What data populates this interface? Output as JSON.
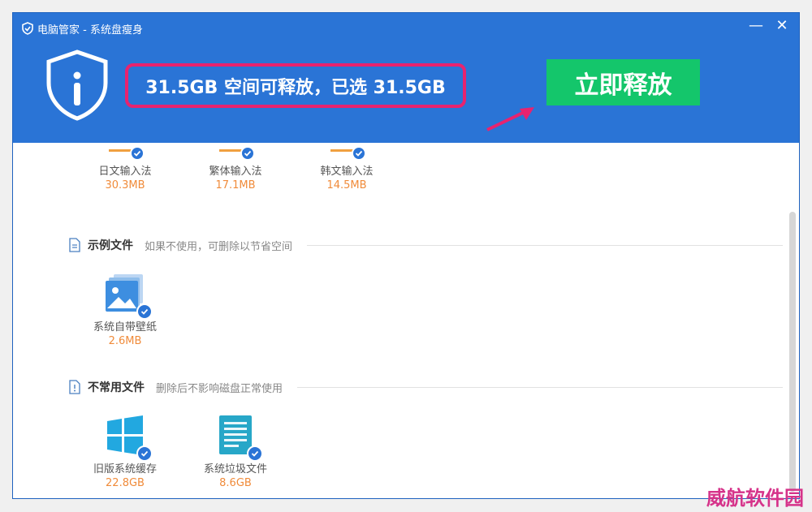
{
  "window": {
    "title": "电脑管家 - 系统盘瘦身"
  },
  "header": {
    "status_text": "31.5GB 空间可释放，已选 31.5GB",
    "release_button": "立即释放",
    "colors": {
      "header_bg": "#2a74d6",
      "button_bg": "#14c66b",
      "highlight": "#e8236f"
    }
  },
  "ime_items": [
    {
      "label": "日文输入法",
      "size": "30.3MB"
    },
    {
      "label": "繁体输入法",
      "size": "17.1MB"
    },
    {
      "label": "韩文输入法",
      "size": "14.5MB"
    }
  ],
  "sections": [
    {
      "title": "示例文件",
      "desc": "如果不使用，可删除以节省空间",
      "items": [
        {
          "label": "系统自带壁纸",
          "size": "2.6MB",
          "icon": "wallpaper-icon"
        }
      ]
    },
    {
      "title": "不常用文件",
      "desc": "删除后不影响磁盘正常使用",
      "items": [
        {
          "label": "旧版系统缓存",
          "size": "22.8GB",
          "icon": "windows-icon"
        },
        {
          "label": "系统垃圾文件",
          "size": "8.6GB",
          "icon": "document-icon"
        }
      ]
    }
  ],
  "watermark": "威航软件园"
}
